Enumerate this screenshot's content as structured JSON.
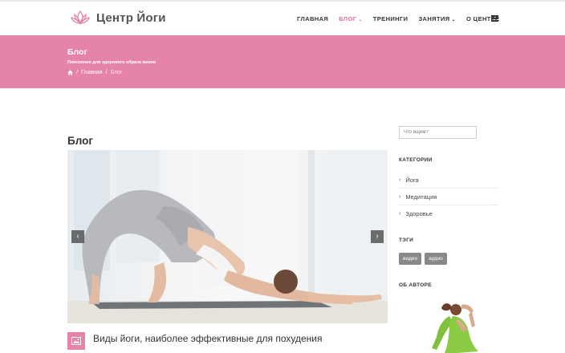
{
  "header": {
    "logo_text": "Центр Йоги",
    "nav": [
      {
        "label": "ГЛАВНАЯ",
        "active": false,
        "dropdown": false
      },
      {
        "label": "БЛОГ",
        "active": true,
        "dropdown": true
      },
      {
        "label": "ТРЕНИНГИ",
        "active": false,
        "dropdown": false
      },
      {
        "label": "ЗАНЯТИЯ",
        "active": false,
        "dropdown": true
      },
      {
        "label": "О ЦЕНТРЕ",
        "active": false,
        "dropdown": false
      }
    ],
    "menu_icon": "hamburger-icon"
  },
  "hero": {
    "title": "Блог",
    "subtitle": "Пояснение для здорового образа жизни",
    "breadcrumbs": {
      "home_icon": "home-icon",
      "items": [
        "Главная",
        "Блог"
      ]
    }
  },
  "main": {
    "heading": "Блог",
    "post": {
      "title": "Виды йоги, наиболее эффективные для похудения",
      "badge_icon": "image-icon"
    },
    "slider": {
      "prev_icon": "chevron-left-icon",
      "next_icon": "chevron-right-icon"
    }
  },
  "sidebar": {
    "search_placeholder": "Что ищем?",
    "categories_title": "КАТЕГОРИИ",
    "categories": [
      "Йога",
      "Медитация",
      "Здоровье"
    ],
    "tags_title": "ТЭГИ",
    "tags": [
      "видео",
      "аудио"
    ],
    "author_title": "ОБ АВТОРЕ"
  },
  "colors": {
    "accent": "#e683a9",
    "nav_active": "#e0739e",
    "text": "#333333"
  }
}
